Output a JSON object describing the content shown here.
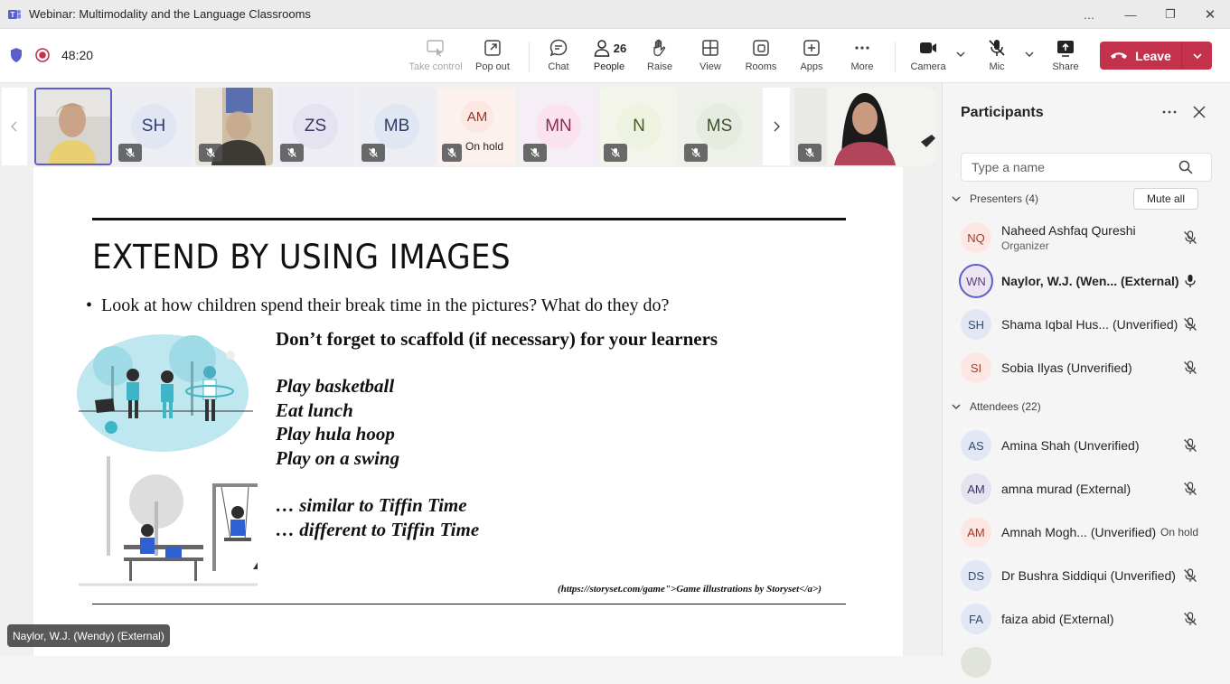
{
  "window": {
    "title": "Webinar: Multimodality and the Language Classrooms",
    "controls": [
      "…",
      "—",
      "❐",
      "✕"
    ]
  },
  "toolbar": {
    "timer": "48:20",
    "buttons": {
      "take_control": "Take control",
      "pop_out": "Pop out",
      "chat": "Chat",
      "people": "People",
      "people_count": "26",
      "raise": "Raise",
      "view": "View",
      "rooms": "Rooms",
      "apps": "Apps",
      "more": "More",
      "camera": "Camera",
      "mic": "Mic",
      "share": "Share",
      "leave": "Leave"
    },
    "colors": {
      "leave": "#c4314b",
      "accent": "#5b5fc7"
    }
  },
  "video_strip": {
    "tiles": [
      {
        "initials": "",
        "muted": false,
        "kind": "video"
      },
      {
        "initials": "SH",
        "muted": true,
        "bg": "#e2e6f3",
        "fg": "#2f3a6e"
      },
      {
        "initials": "",
        "muted": true,
        "kind": "video"
      },
      {
        "initials": "ZS",
        "muted": true,
        "bg": "#e6e3f0",
        "fg": "#3d3566"
      },
      {
        "initials": "MB",
        "muted": true,
        "bg": "#e0e6f2",
        "fg": "#2c3b66"
      },
      {
        "initials": "AM",
        "muted": true,
        "bg": "#fde7e2",
        "fg": "#8a3a2a",
        "status": "On hold"
      },
      {
        "initials": "MN",
        "muted": true,
        "bg": "#fbe3ee",
        "fg": "#8a2d56"
      },
      {
        "initials": "N",
        "muted": true,
        "bg": "#eef2e0",
        "fg": "#4b5a22"
      },
      {
        "initials": "MS",
        "muted": true,
        "bg": "#e6ebe0",
        "fg": "#3e4d2e"
      }
    ]
  },
  "slide": {
    "title": "EXTEND BY USING IMAGES",
    "bullet": "Look at how children spend their break time in the pictures? What do they do?",
    "scaffold": "Don’t forget to scaffold (if necessary) for your learners",
    "activities": [
      "Play basketball",
      "Eat lunch",
      "Play hula hoop",
      "Play on a swing"
    ],
    "comparisons": [
      "… similar to Tiffin Time",
      "… different to Tiffin Time"
    ],
    "credit": "(https://storyset.com/game\">Game illustrations by Storyset</a>)"
  },
  "speaker_tag": "Naylor, W.J. (Wendy) (External)",
  "panel": {
    "title": "Participants",
    "search_placeholder": "Type a name",
    "presenters_label": "Presenters (4)",
    "mute_all": "Mute all",
    "attendees_label": "Attendees (22)",
    "presenters": [
      {
        "initials": "NQ",
        "name": "Naheed Ashfaq Qureshi",
        "sub": "Organizer",
        "mic": "off",
        "bg": "#fde7e2",
        "fg": "#a33a2b"
      },
      {
        "initials": "WN",
        "name": "Naylor, W.J. (Wen...  (External)",
        "mic": "on",
        "bg": "#ece6f3",
        "fg": "#5a3d7a",
        "speaking": true
      },
      {
        "initials": "SH",
        "name": "Shama Iqbal Hus... (Unverified)",
        "mic": "off",
        "bg": "#e2e8f3",
        "fg": "#2f4a74"
      },
      {
        "initials": "SI",
        "name": "Sobia Ilyas (Unverified)",
        "mic": "off",
        "bg": "#fde7e2",
        "fg": "#a33a2b"
      }
    ],
    "attendees": [
      {
        "initials": "AS",
        "name": "Amina Shah (Unverified)",
        "mic": "off",
        "bg": "#e2e8f3",
        "fg": "#2f4a74"
      },
      {
        "initials": "AM",
        "name": "amna murad (External)",
        "mic": "off",
        "bg": "#e6e3f0",
        "fg": "#3d3566"
      },
      {
        "initials": "AM",
        "name": "Amnah Mogh... (Unverified)",
        "status": "On hold",
        "bg": "#fde7e2",
        "fg": "#a33a2b"
      },
      {
        "initials": "DS",
        "name": "Dr Bushra Siddiqui (Unverified)",
        "mic": "off",
        "bg": "#e2e8f3",
        "fg": "#2f4a74"
      },
      {
        "initials": "FA",
        "name": "faiza abid (External)",
        "mic": "off",
        "bg": "#e2e8f3",
        "fg": "#2f4a74"
      }
    ]
  }
}
